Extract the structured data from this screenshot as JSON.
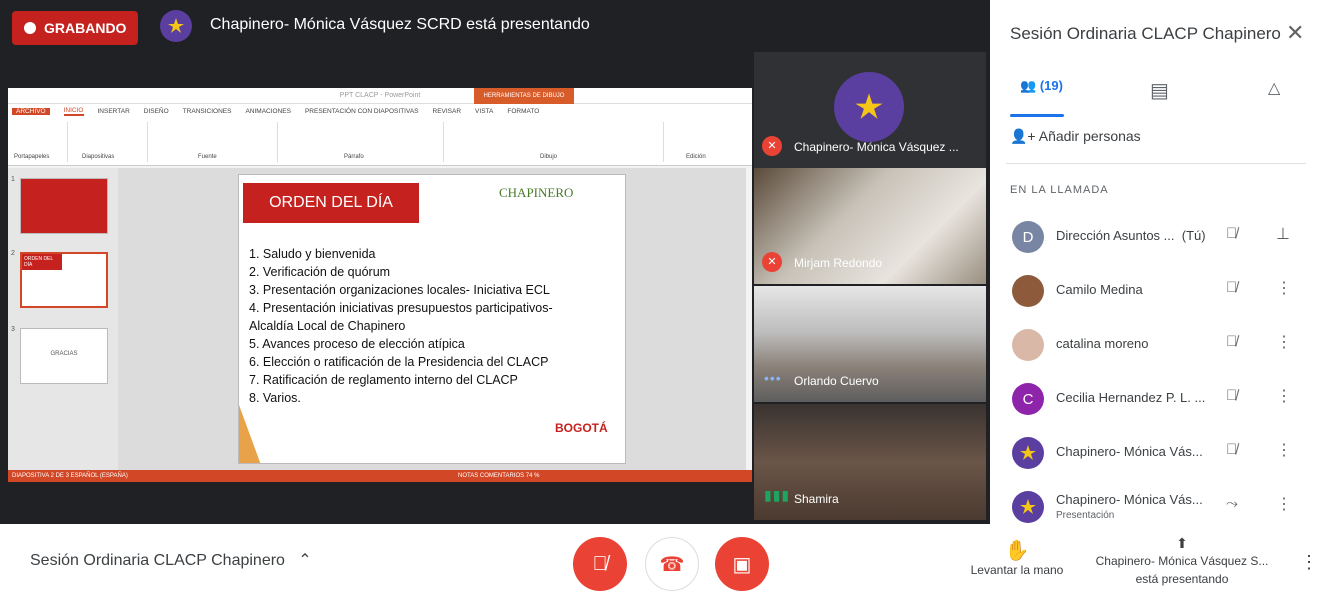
{
  "header": {
    "recording_label": "GRABANDO",
    "presenting_text": "Chapinero- Mónica Vásquez SCRD está presentando"
  },
  "ppt": {
    "window_title": "PPT CLACP - PowerPoint",
    "drawing_tools": "HERRAMIENTAS DE DIBUJO",
    "tabs": [
      "ARCHIVO",
      "INICIO",
      "INSERTAR",
      "DISEÑO",
      "TRANSICIONES",
      "ANIMACIONES",
      "PRESENTACIÓN CON DIAPOSITIVAS",
      "REVISAR",
      "VISTA",
      "FORMATO"
    ],
    "ribbon_groups": [
      "Portapapeles",
      "Diapositivas",
      "Fuente",
      "Párrafo",
      "Dibujo",
      "Edición"
    ],
    "thumb_2_title": "ORDEN DEL DÍA",
    "thumb_3_text": "GRACIAS",
    "status": "DIAPOSITIVA 2 DE 3    ESPAÑOL (ESPAÑA)",
    "status_right": "NOTAS   COMENTARIOS   74 %",
    "slide": {
      "header": "ORDEN DEL DÍA",
      "chapinero": "CHAPINERO",
      "agenda": [
        "1.   Saludo y bienvenida",
        "2.   Verificación de quórum",
        "3.   Presentación organizaciones locales- Iniciativa ECL",
        "4.   Presentación iniciativas presupuestos participativos-",
        "      Alcaldía Local de Chapinero",
        "5.   Avances proceso de elección atípica",
        "6.   Elección o ratificación de la Presidencia del CLACP",
        "7.   Ratificación de reglamento interno del CLACP",
        "8.   Varios."
      ],
      "logo_text": "BOGOTÁ"
    }
  },
  "tiles": [
    {
      "name": "Chapinero- Mónica Vásquez ...",
      "status": "muted"
    },
    {
      "name": "Mirjam Redondo",
      "status": "muted"
    },
    {
      "name": "Orlando Cuervo",
      "status": "dots"
    },
    {
      "name": "Shamira",
      "status": "speaking"
    }
  ],
  "panel": {
    "title": "Sesión Ordinaria CLACP Chapinero",
    "people_count": "(19)",
    "add_people": "Añadir personas",
    "in_call": "EN LA LLAMADA",
    "participants": [
      {
        "name": "Dirección Asuntos ...",
        "tag": "(Tú)",
        "initial": "D",
        "color": "#7986a3"
      },
      {
        "name": "Camilo Medina",
        "initial": "",
        "color": "#8d5a3b"
      },
      {
        "name": "catalina moreno",
        "initial": "",
        "color": "#d9b8a8"
      },
      {
        "name": "Cecilia Hernandez P. L. ...",
        "initial": "C",
        "color": "#8e24aa"
      },
      {
        "name": "Chapinero- Mónica Vás...",
        "initial": "",
        "color": "#5b3fa0"
      },
      {
        "name": "Chapinero- Mónica Vás...",
        "sub": "Presentación",
        "initial": "",
        "color": "#5b3fa0"
      }
    ]
  },
  "bottom": {
    "meeting_name": "Sesión Ordinaria CLACP Chapinero",
    "raise_hand": "Levantar la mano",
    "presenting_line1": "Chapinero- Mónica Vásquez S...",
    "presenting_line2": "está presentando"
  }
}
